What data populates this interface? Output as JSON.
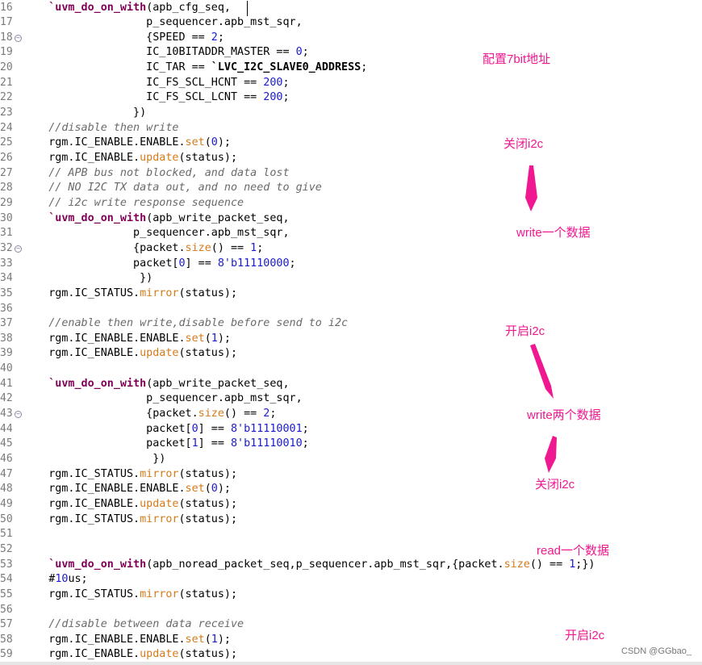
{
  "editor": {
    "lines": [
      {
        "n": "16",
        "t": [
          [
            "s",
            "    "
          ],
          [
            "macro",
            "`uvm_do_on_with"
          ],
          [
            "p",
            "(apb_cfg_seq,"
          ]
        ]
      },
      {
        "n": "17",
        "t": [
          [
            "p",
            "                   p_sequencer.apb_mst_sqr,"
          ]
        ]
      },
      {
        "n": "18",
        "fold": true,
        "t": [
          [
            "p",
            "                   {SPEED == "
          ],
          [
            "num",
            "2"
          ],
          [
            "p",
            ";"
          ]
        ]
      },
      {
        "n": "19",
        "t": [
          [
            "p",
            "                   IC_10BITADDR_MASTER == "
          ],
          [
            "num",
            "0"
          ],
          [
            "p",
            ";"
          ]
        ]
      },
      {
        "n": "20",
        "t": [
          [
            "p",
            "                   IC_TAR == "
          ],
          [
            "bold",
            "`LVC_I2C_SLAVE0_ADDRESS"
          ],
          [
            "p",
            ";"
          ]
        ]
      },
      {
        "n": "21",
        "t": [
          [
            "p",
            "                   IC_FS_SCL_HCNT == "
          ],
          [
            "num",
            "200"
          ],
          [
            "p",
            ";"
          ]
        ]
      },
      {
        "n": "22",
        "t": [
          [
            "p",
            "                   IC_FS_SCL_LCNT == "
          ],
          [
            "num",
            "200"
          ],
          [
            "p",
            ";"
          ]
        ]
      },
      {
        "n": "23",
        "t": [
          [
            "p",
            "                 })"
          ]
        ]
      },
      {
        "n": "24",
        "t": [
          [
            "comment",
            "    //disable then write"
          ]
        ]
      },
      {
        "n": "25",
        "t": [
          [
            "p",
            "    rgm.IC_ENABLE.ENABLE."
          ],
          [
            "method",
            "set"
          ],
          [
            "p",
            "("
          ],
          [
            "num",
            "0"
          ],
          [
            "p",
            ");"
          ]
        ]
      },
      {
        "n": "26",
        "t": [
          [
            "p",
            "    rgm.IC_ENABLE."
          ],
          [
            "method",
            "update"
          ],
          [
            "p",
            "(status);"
          ]
        ]
      },
      {
        "n": "27",
        "t": [
          [
            "comment",
            "    // APB bus not blocked, and data lost"
          ]
        ]
      },
      {
        "n": "28",
        "t": [
          [
            "comment",
            "    // NO I2C TX data out, and no need to give"
          ]
        ]
      },
      {
        "n": "29",
        "t": [
          [
            "comment",
            "    // i2c write response sequence"
          ]
        ]
      },
      {
        "n": "30",
        "t": [
          [
            "s",
            "    "
          ],
          [
            "macro",
            "`uvm_do_on_with"
          ],
          [
            "p",
            "(apb_write_packet_seq,"
          ]
        ]
      },
      {
        "n": "31",
        "t": [
          [
            "p",
            "                 p_sequencer.apb_mst_sqr,"
          ]
        ]
      },
      {
        "n": "32",
        "fold": true,
        "t": [
          [
            "p",
            "                 {packet."
          ],
          [
            "method",
            "size"
          ],
          [
            "p",
            "() == "
          ],
          [
            "num",
            "1"
          ],
          [
            "p",
            ";"
          ]
        ]
      },
      {
        "n": "33",
        "t": [
          [
            "p",
            "                 packet["
          ],
          [
            "num",
            "0"
          ],
          [
            "p",
            "] == "
          ],
          [
            "num",
            "8'b11110000"
          ],
          [
            "p",
            ";"
          ]
        ]
      },
      {
        "n": "34",
        "t": [
          [
            "p",
            "                  })"
          ]
        ]
      },
      {
        "n": "35",
        "t": [
          [
            "p",
            "    rgm.IC_STATUS."
          ],
          [
            "method",
            "mirror"
          ],
          [
            "p",
            "(status);"
          ]
        ]
      },
      {
        "n": "36",
        "t": []
      },
      {
        "n": "37",
        "t": [
          [
            "comment",
            "    //enable then write,disable before send to i2c"
          ]
        ]
      },
      {
        "n": "38",
        "t": [
          [
            "p",
            "    rgm.IC_ENABLE.ENABLE."
          ],
          [
            "method",
            "set"
          ],
          [
            "p",
            "("
          ],
          [
            "num",
            "1"
          ],
          [
            "p",
            ");"
          ]
        ]
      },
      {
        "n": "39",
        "t": [
          [
            "p",
            "    rgm.IC_ENABLE."
          ],
          [
            "method",
            "update"
          ],
          [
            "p",
            "(status);"
          ]
        ]
      },
      {
        "n": "40",
        "t": []
      },
      {
        "n": "41",
        "t": [
          [
            "s",
            "    "
          ],
          [
            "macro",
            "`uvm_do_on_with"
          ],
          [
            "p",
            "(apb_write_packet_seq,"
          ]
        ]
      },
      {
        "n": "42",
        "t": [
          [
            "p",
            "                   p_sequencer.apb_mst_sqr,"
          ]
        ]
      },
      {
        "n": "43",
        "fold": true,
        "t": [
          [
            "p",
            "                   {packet."
          ],
          [
            "method",
            "size"
          ],
          [
            "p",
            "() == "
          ],
          [
            "num",
            "2"
          ],
          [
            "p",
            ";"
          ]
        ]
      },
      {
        "n": "44",
        "t": [
          [
            "p",
            "                   packet["
          ],
          [
            "num",
            "0"
          ],
          [
            "p",
            "] == "
          ],
          [
            "num",
            "8'b11110001"
          ],
          [
            "p",
            ";"
          ]
        ]
      },
      {
        "n": "45",
        "t": [
          [
            "p",
            "                   packet["
          ],
          [
            "num",
            "1"
          ],
          [
            "p",
            "] == "
          ],
          [
            "num",
            "8'b11110010"
          ],
          [
            "p",
            ";"
          ]
        ]
      },
      {
        "n": "46",
        "t": [
          [
            "p",
            "                    })"
          ]
        ]
      },
      {
        "n": "47",
        "t": [
          [
            "p",
            "    rgm.IC_STATUS."
          ],
          [
            "method",
            "mirror"
          ],
          [
            "p",
            "(status);"
          ]
        ]
      },
      {
        "n": "48",
        "t": [
          [
            "p",
            "    rgm.IC_ENABLE.ENABLE."
          ],
          [
            "method",
            "set"
          ],
          [
            "p",
            "("
          ],
          [
            "num",
            "0"
          ],
          [
            "p",
            ");"
          ]
        ]
      },
      {
        "n": "49",
        "t": [
          [
            "p",
            "    rgm.IC_ENABLE."
          ],
          [
            "method",
            "update"
          ],
          [
            "p",
            "(status);"
          ]
        ]
      },
      {
        "n": "50",
        "t": [
          [
            "p",
            "    rgm.IC_STATUS."
          ],
          [
            "method",
            "mirror"
          ],
          [
            "p",
            "(status);"
          ]
        ]
      },
      {
        "n": "51",
        "t": []
      },
      {
        "n": "52",
        "t": []
      },
      {
        "n": "53",
        "t": [
          [
            "s",
            "    "
          ],
          [
            "macro",
            "`uvm_do_on_with"
          ],
          [
            "p",
            "(apb_noread_packet_seq,p_sequencer.apb_mst_sqr,{packet."
          ],
          [
            "method",
            "size"
          ],
          [
            "p",
            "() == "
          ],
          [
            "num",
            "1"
          ],
          [
            "p",
            ";})"
          ]
        ]
      },
      {
        "n": "54",
        "t": [
          [
            "p",
            "    #"
          ],
          [
            "num",
            "10"
          ],
          [
            "p",
            "us;"
          ]
        ]
      },
      {
        "n": "55",
        "t": [
          [
            "p",
            "    rgm.IC_STATUS."
          ],
          [
            "method",
            "mirror"
          ],
          [
            "p",
            "(status);"
          ]
        ]
      },
      {
        "n": "56",
        "t": []
      },
      {
        "n": "57",
        "t": [
          [
            "comment",
            "    //disable between data receive"
          ]
        ]
      },
      {
        "n": "58",
        "t": [
          [
            "p",
            "    rgm.IC_ENABLE.ENABLE."
          ],
          [
            "method",
            "set"
          ],
          [
            "p",
            "("
          ],
          [
            "num",
            "1"
          ],
          [
            "p",
            ");"
          ]
        ]
      },
      {
        "n": "59",
        "t": [
          [
            "p",
            "    rgm.IC_ENABLE."
          ],
          [
            "method",
            "update"
          ],
          [
            "p",
            "(status);"
          ]
        ]
      }
    ]
  },
  "annotations": {
    "config_7bit": "配置7bit地址",
    "close_i2c_1": "关闭i2c",
    "write_one": "write一个数据",
    "open_i2c_1": "开启i2c",
    "write_two": "write两个数据",
    "close_i2c_2": "关闭i2c",
    "read_one": "read一个数据",
    "open_i2c_2": "开启i2c",
    "color": "#f01890"
  },
  "watermark": "CSDN @GGbao_"
}
